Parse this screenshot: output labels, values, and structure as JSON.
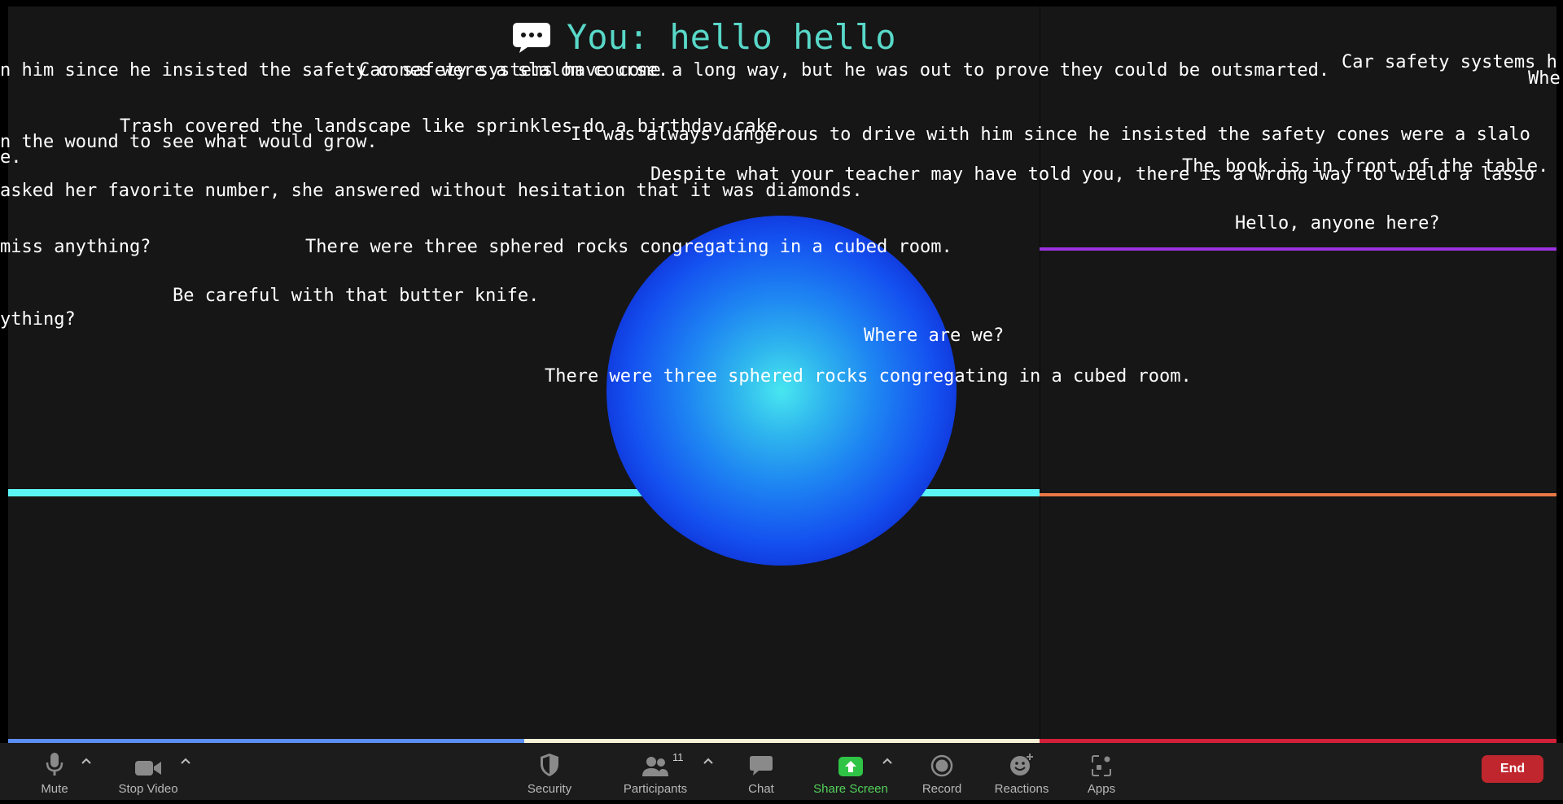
{
  "speech": {
    "text": "You: hello hello",
    "icon": "speech-bubble-icon"
  },
  "captions": [
    "n him since he insisted the safety cones were a slalom course.",
    "Car safety systems have come a long way, but he was out to prove they could be outsmarted.",
    "Car safety systems h",
    "Whe",
    "Trash covered the landscape like sprinkles do a birthday cake.",
    "It was always dangerous to drive with him since he insisted the safety cones were a slalo",
    "n the wound to see what would grow.",
    "e.",
    "The book is in front of the table.",
    "Despite what your teacher may have told you, there is a wrong way to wield a lasso",
    "asked her favorite number, she answered without hesitation that it was diamonds.",
    "Hello, anyone here?",
    "miss anything?",
    "There were three sphered rocks congregating in a cubed room.",
    "Be careful with that butter knife.",
    "ything?",
    "Where are we?",
    "There were three sphered rocks congregating in a cubed room."
  ],
  "toolbar": {
    "mute": {
      "label": "Mute",
      "icon": "microphone-icon"
    },
    "stop_video": {
      "label": "Stop Video",
      "icon": "video-camera-icon"
    },
    "security": {
      "label": "Security",
      "icon": "shield-icon"
    },
    "participants": {
      "label": "Participants",
      "icon": "participants-icon",
      "count": "11"
    },
    "chat": {
      "label": "Chat",
      "icon": "chat-icon"
    },
    "share_screen": {
      "label": "Share Screen",
      "icon": "share-screen-icon"
    },
    "record": {
      "label": "Record",
      "icon": "record-icon"
    },
    "reactions": {
      "label": "Reactions",
      "icon": "reactions-icon"
    },
    "apps": {
      "label": "Apps",
      "icon": "apps-icon"
    },
    "end": {
      "label": "End"
    }
  },
  "colors": {
    "speech_text": "#58d8c8",
    "bar_cyan": "#5cf5f7",
    "bar_green": "#2f8a1a",
    "bar_purple": "#9b32e0",
    "bar_orange": "#e87846",
    "bar_blue": "#5a8ef2",
    "bar_cream": "#f6f0d6",
    "bar_red": "#d2203a",
    "share_green": "#2fc446",
    "end_red": "#c0262d"
  }
}
